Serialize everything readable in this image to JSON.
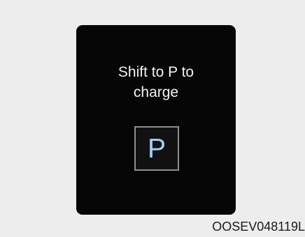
{
  "display": {
    "message_line1": "Shift to P to",
    "message_line2": "charge",
    "gear_indicator": "P"
  },
  "caption": {
    "figure_code": "OOSEV048119L"
  },
  "colors": {
    "page_background": "#ededed",
    "panel_background": "#050505",
    "message_text": "#f2f2f2",
    "gear_letter": "#9fd3f7",
    "gear_border": "#8f8f8f"
  }
}
